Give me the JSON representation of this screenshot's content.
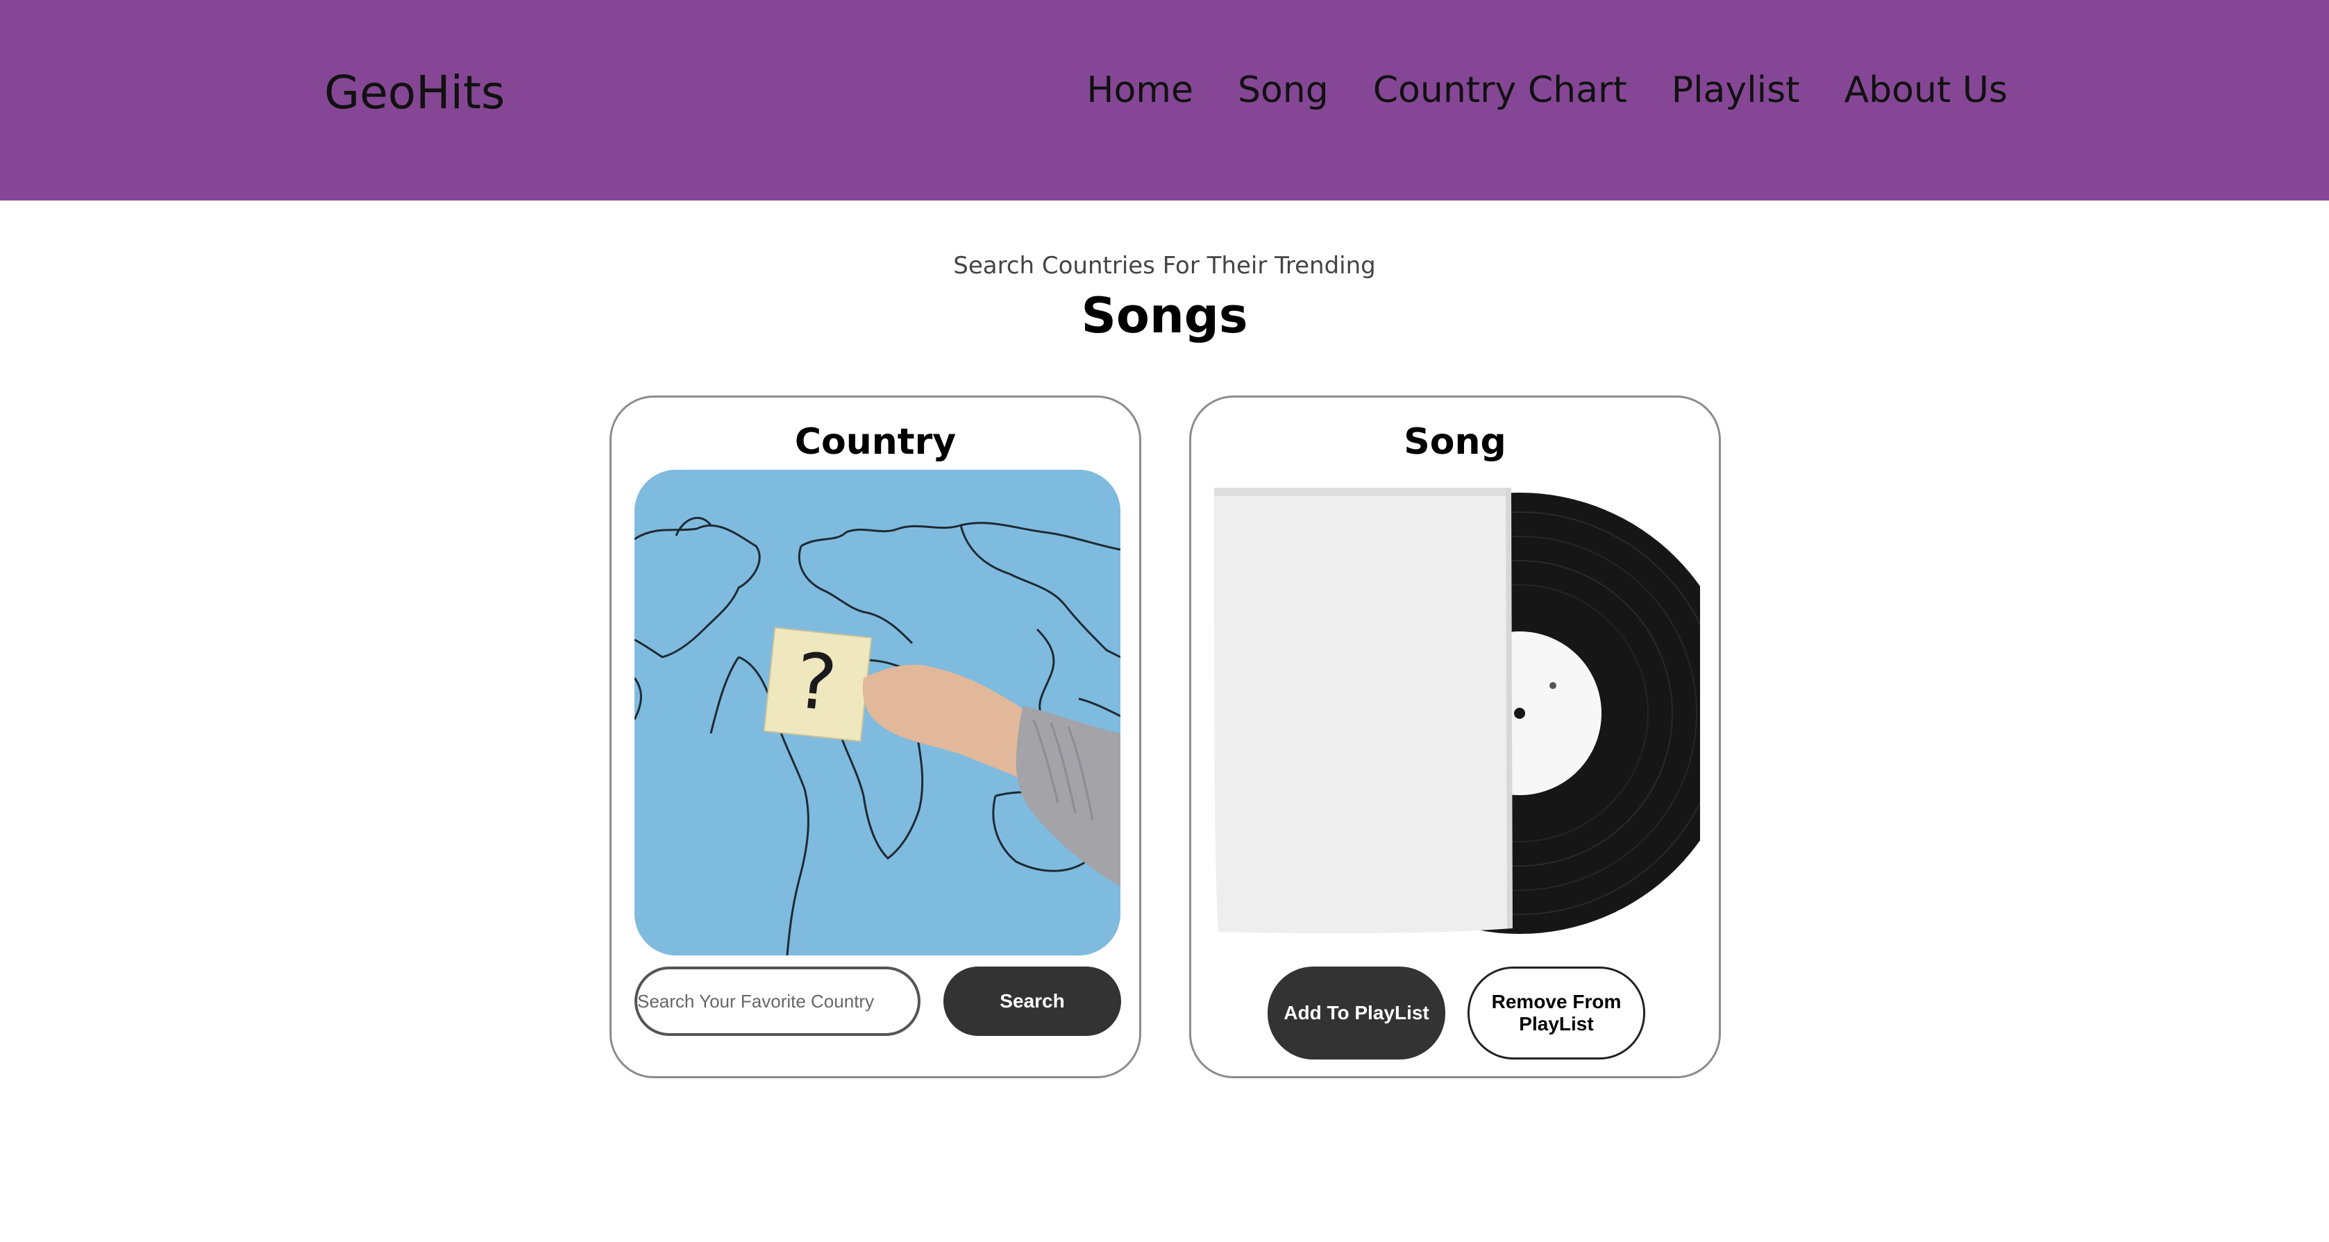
{
  "navbar": {
    "brand": "GeoHits",
    "links": [
      {
        "label": "Home"
      },
      {
        "label": "Song"
      },
      {
        "label": "Country Chart"
      },
      {
        "label": "Playlist"
      },
      {
        "label": "About Us"
      }
    ],
    "background_color": "#854795"
  },
  "hero": {
    "subtitle": "Search Countries For Their Trending",
    "heading": "Songs"
  },
  "country_card": {
    "title": "Country",
    "image_icon": "world-map-question-icon",
    "search_placeholder": "Search Your Favorite Country",
    "search_value": "",
    "search_button": "Search"
  },
  "song_card": {
    "title": "Song",
    "image_icon": "vinyl-record-icon",
    "add_button": "Add To PlayList",
    "remove_button": "Remove From PlayList"
  },
  "colors": {
    "accent": "#854795",
    "dark_button": "#333333"
  }
}
